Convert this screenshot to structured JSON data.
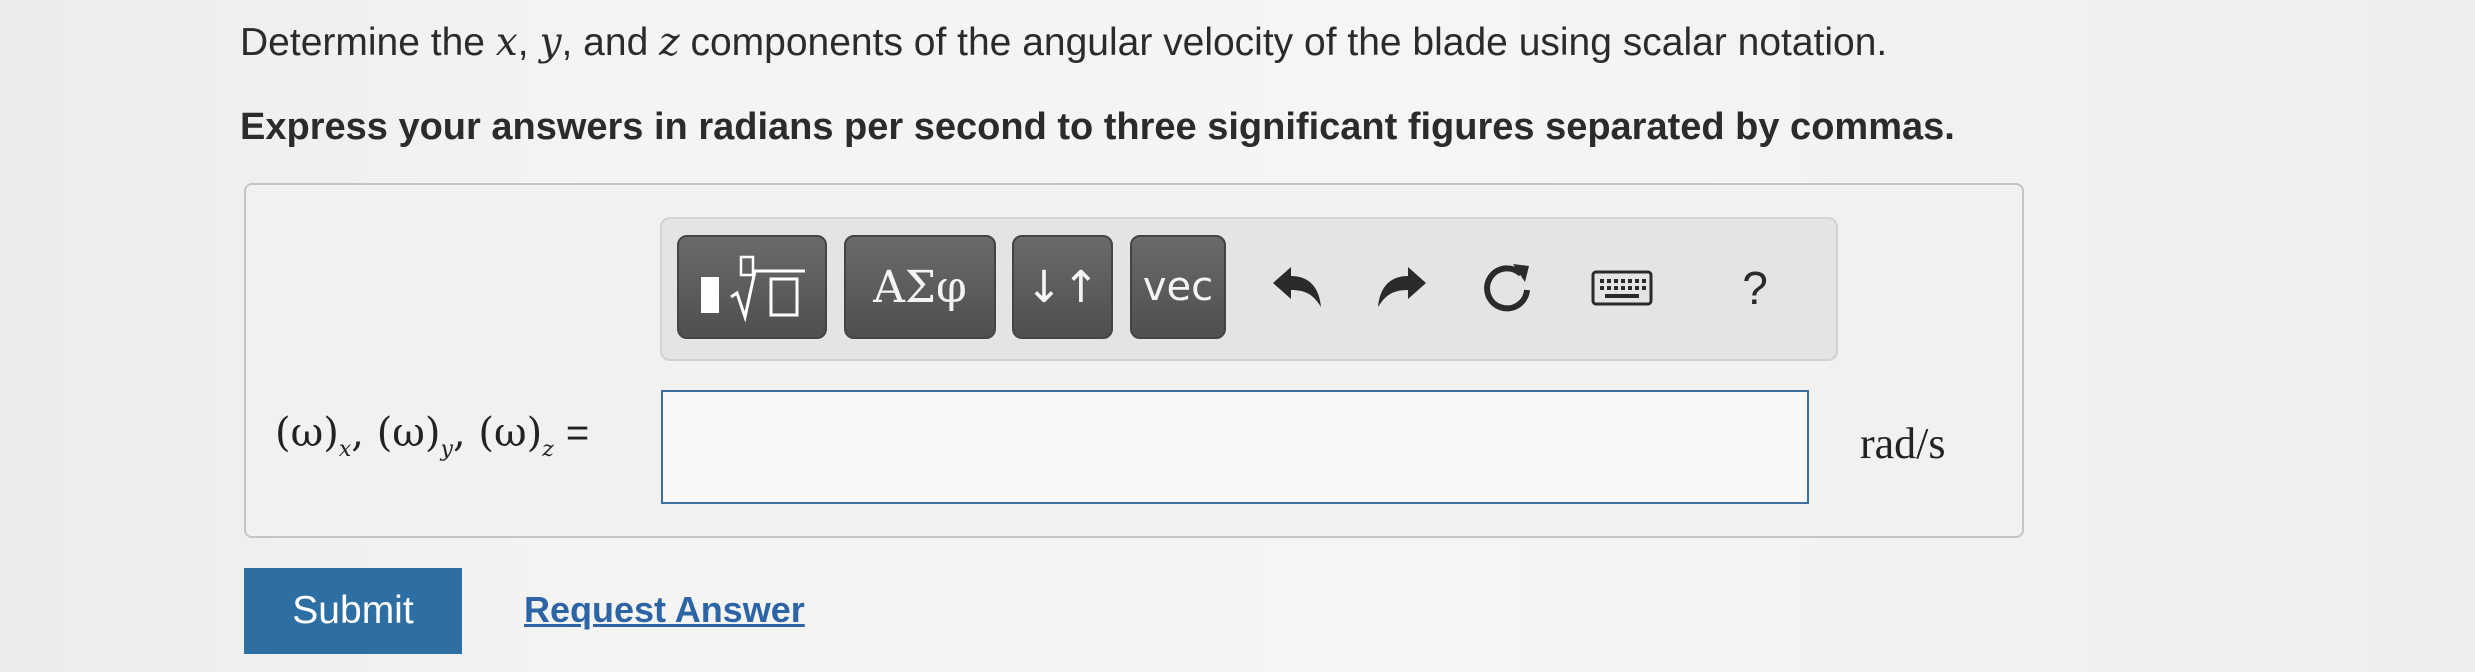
{
  "question": {
    "prefix": "Determine the ",
    "var_x": "x",
    "sep1": ", ",
    "var_y": "y",
    "sep2": ", and ",
    "var_z": "z",
    "suffix": " components of the angular velocity of the blade using scalar notation."
  },
  "instruction": "Express your answers in radians per second to three significant figures separated by commas.",
  "toolbar": {
    "greek_label": "ΑΣφ",
    "arrows_label": "↓↑",
    "vec_label": "vec",
    "help_label": "?",
    "icons": [
      "templates-icon",
      "undo-icon",
      "redo-icon",
      "reset-icon",
      "keyboard-icon",
      "help-icon"
    ]
  },
  "answer": {
    "omega": "(ω)",
    "sub_x": "x",
    "sub_y": "y",
    "sub_z": "z",
    "comma": ", ",
    "equals": "=",
    "value": "",
    "unit": "rad/s"
  },
  "actions": {
    "submit_label": "Submit",
    "request_label": "Request Answer"
  },
  "colors": {
    "submit_bg": "#2e6fa3",
    "link": "#2c64a5",
    "input_border": "#3e6f9c",
    "toolbar_button": "#5a5a5a"
  }
}
